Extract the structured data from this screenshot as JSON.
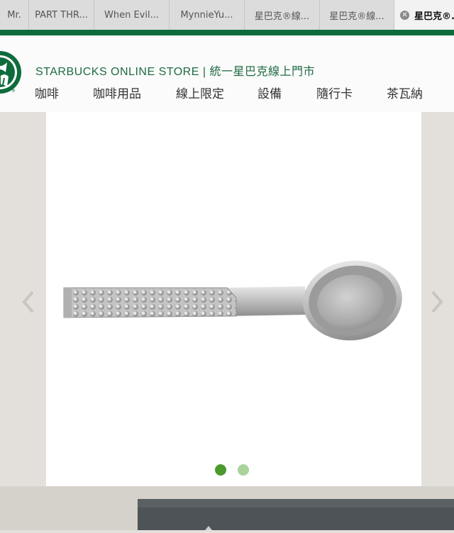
{
  "tabs": [
    {
      "label": "Mr."
    },
    {
      "label": "PART THR..."
    },
    {
      "label": "When Evil..."
    },
    {
      "label": "MynnieYu..."
    },
    {
      "label": "星巴克®線..."
    },
    {
      "label": "星巴克®線..."
    },
    {
      "label": "星巴克®..."
    }
  ],
  "header": {
    "brand": "STARBUCKS ONLINE STORE | 統一星巴克線上門市",
    "nav": [
      "咖啡",
      "咖啡用品",
      "線上限定",
      "設備",
      "隨行卡",
      "茶瓦納"
    ]
  },
  "carousel": {
    "current_slide": 1,
    "total_slides": 2
  },
  "colors": {
    "brand_green": "#0e6b3d",
    "dot_active": "#4a9a2e",
    "dot_inactive": "#a9d39a"
  }
}
